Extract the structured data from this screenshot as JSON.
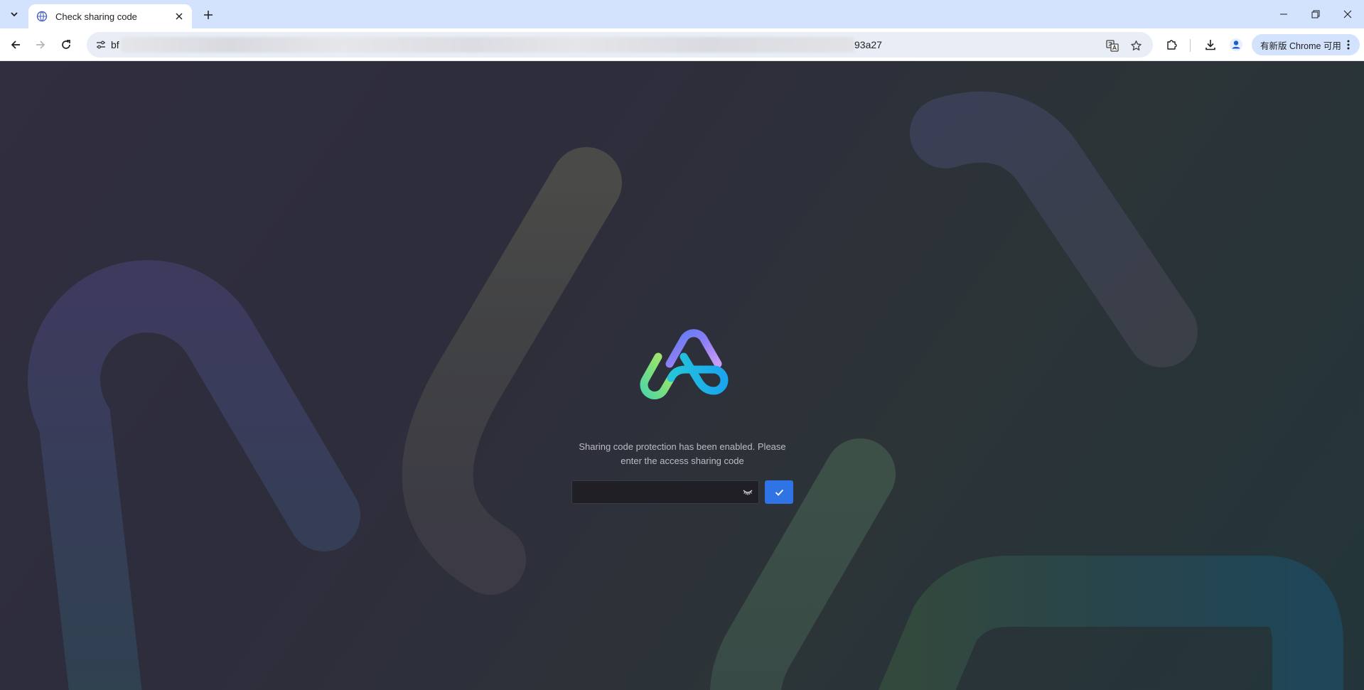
{
  "browser": {
    "tab": {
      "title": "Check sharing code",
      "favicon": "globe-favicon-icon"
    },
    "url": {
      "start": "bf",
      "end": "93a27"
    },
    "update_chip": {
      "label": "有新版 Chrome 可用"
    },
    "icons": {
      "tab_search": "chevron-down-icon",
      "tab_close": "close-icon",
      "new_tab": "plus-icon",
      "back": "back-arrow-icon",
      "forward": "forward-arrow-icon",
      "reload": "reload-icon",
      "site_info": "tune-icon",
      "translate": "translate-icon",
      "bookmark": "star-icon",
      "extensions": "puzzle-icon",
      "downloads": "download-icon",
      "profile": "profile-icon",
      "menu": "kebab-menu-icon"
    }
  },
  "page": {
    "message": "Sharing code protection has been enabled. Please enter the access sharing code",
    "input": {
      "value": "",
      "placeholder": ""
    },
    "icons": {
      "toggle_visibility": "eye-closed-icon",
      "submit": "check-icon",
      "logo": "app-logo-icon"
    },
    "colors": {
      "submit": "#2f73e4",
      "background": "#2e2d3c"
    }
  }
}
